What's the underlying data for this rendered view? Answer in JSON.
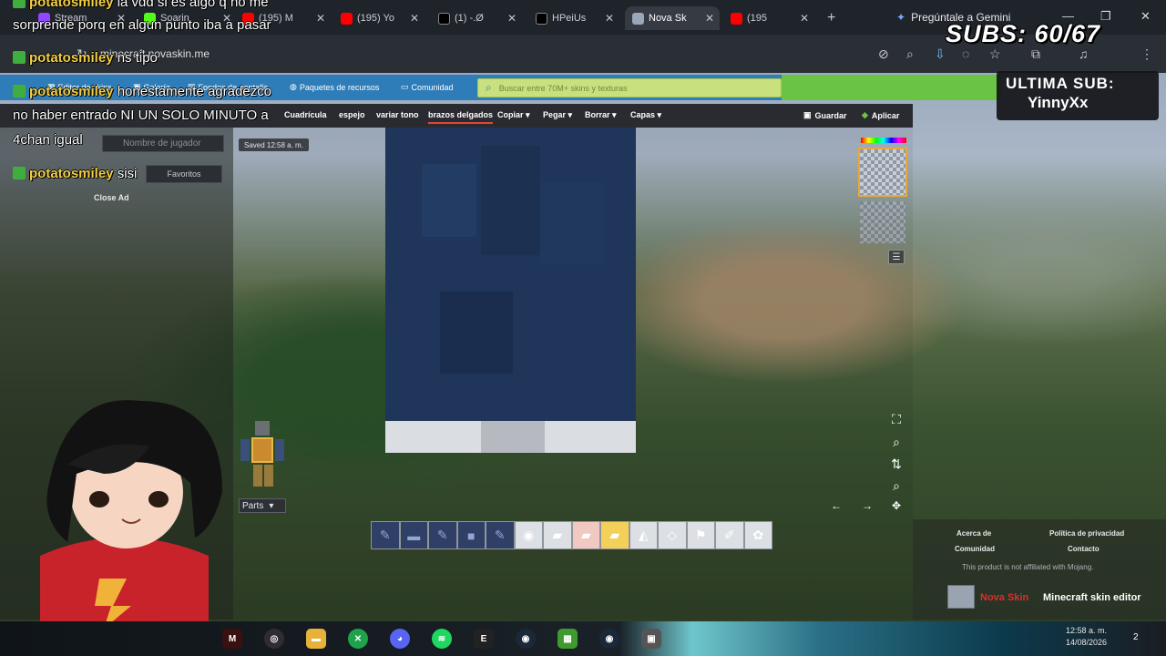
{
  "browser": {
    "tabs": [
      {
        "label": "Stream",
        "icon": "twitch-icon",
        "color": "#9146ff"
      },
      {
        "label": "Soarin",
        "icon": "kick-icon",
        "color": "#53fc18"
      },
      {
        "label": "(195) M",
        "icon": "youtube-icon",
        "color": "#ff0000"
      },
      {
        "label": "(195) Yo",
        "icon": "youtube-icon",
        "color": "#ff0000"
      },
      {
        "label": "(1) -.Ø",
        "icon": "x-icon",
        "color": "#ffffff"
      },
      {
        "label": "HPeiUs",
        "icon": "x-icon",
        "color": "#ffffff"
      },
      {
        "label": "Nova Sk",
        "icon": "novaskin-icon",
        "color": "#9aa7b8"
      },
      {
        "label": "(195",
        "icon": "youtube-icon",
        "color": "#ff0000"
      }
    ],
    "gemini_label": "Pregúntale a Gemini",
    "url": "minecraft.novaskin.me"
  },
  "site": {
    "nav": [
      "Editor de skins",
      "Galería",
      "Fondos de pantalla",
      "Paquetes de recursos",
      "Comunidad"
    ],
    "search_placeholder": "Buscar entre 70M+ skins y texturas"
  },
  "editor": {
    "toolbar": [
      "Cuadrícula",
      "espejo",
      "variar tono",
      "brazos delgados",
      "Copiar ▾",
      "Pegar ▾",
      "Borrar ▾",
      "Capas ▾"
    ],
    "selected_tab": "brazos delgados",
    "save_label": "Guardar",
    "apply_label": "Aplicar",
    "saved_label": "Saved 12:58 a. m.",
    "player_placeholder": "Nombre de jugador",
    "favorites_label": "Favoritos",
    "close_ad": "Close Ad",
    "parts_label": "Parts",
    "tools": [
      "pencil-icon",
      "fill-icon",
      "pencil-icon",
      "fill-icon",
      "pencil-icon",
      "noise-icon",
      "eraser-icon",
      "eraser-icon",
      "eraser-icon",
      "bucket-icon",
      "eraser-icon",
      "stamp-icon",
      "eyedropper-icon",
      "settings-icon"
    ]
  },
  "footer": {
    "about": "Acerca de",
    "privacy": "Política de privacidad",
    "community": "Comunidad",
    "contact": "Contacto",
    "not_affiliated": "This product is not affiliated with Mojang.",
    "brand_nova": "Nova Skin",
    "brand_editor": "Minecraft skin editor"
  },
  "overlay": {
    "subs": "SUBS: 60/67",
    "last_sub_title": "ULTIMA SUB:",
    "last_sub_name": "YinnyXx"
  },
  "chat": [
    {
      "user": "potatosmiley",
      "text": "la vdd si es algo q no me"
    },
    {
      "user": "",
      "text": "sorprende porq en algun punto iba a pasar"
    },
    {
      "user": "potatosmiley",
      "text": "ns tipo"
    },
    {
      "user": "potatosmiley",
      "text": "honestamente agradezco"
    },
    {
      "user": "",
      "text": "no haber entrado NI UN SOLO MINUTO a"
    },
    {
      "user": "",
      "text": "4chan igual"
    },
    {
      "user": "potatosmiley",
      "text": "sisi"
    }
  ],
  "taskbar": {
    "time": "12:58 a. m.",
    "date": "14/08/2026",
    "notifications": "2",
    "apps": [
      "mcreator-icon",
      "obs-icon",
      "folder-icon",
      "xbox-icon",
      "discord-icon",
      "spotify-icon",
      "epic-icon",
      "steam-icon",
      "minecraft-icon",
      "steam-icon",
      "app-icon"
    ]
  }
}
